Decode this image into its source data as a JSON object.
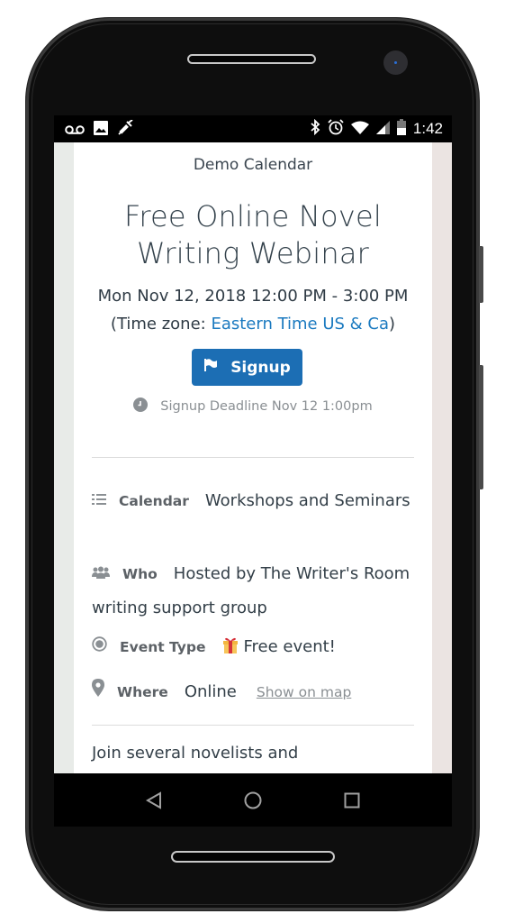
{
  "statusbar": {
    "left_icons": [
      "voicemail-icon",
      "image-icon",
      "syringe-icon"
    ],
    "right_icons": [
      "bluetooth-icon",
      "alarm-icon",
      "wifi-icon",
      "cell-signal-icon",
      "battery-icon"
    ],
    "time": "1:42"
  },
  "page": {
    "calendar_name": "Demo Calendar",
    "event_title": "Free Online Novel Writing Webinar",
    "event_datetime": "Mon Nov 12, 2018 12:00 PM - 3:00 PM",
    "timezone_prefix": "(Time zone: ",
    "timezone_link": "Eastern Time US & Ca",
    "timezone_suffix": ")",
    "signup_label": "Signup",
    "signup_deadline": "Signup Deadline Nov 12 1:00pm",
    "details": {
      "calendar": {
        "label": "Calendar",
        "value": "Workshops and Seminars",
        "icon": "list-icon"
      },
      "who": {
        "label": "Who",
        "value": "Hosted by The Writer's Room writing support group",
        "icon": "users-icon"
      },
      "event_type": {
        "label": "Event Type",
        "value": "Free event!",
        "icon": "radio-icon",
        "value_icon": "gift-icon"
      },
      "where": {
        "label": "Where",
        "value": "Online",
        "link": "Show on map",
        "icon": "map-marker-icon"
      }
    },
    "description_start": "Join several novelists and"
  },
  "navbar": {
    "back": "back-icon",
    "home": "home-icon",
    "recents": "recents-icon"
  },
  "colors": {
    "accent": "#1c6eb4",
    "link": "#1b7ac0",
    "text": "#333f48",
    "muted": "#8a8f93"
  }
}
